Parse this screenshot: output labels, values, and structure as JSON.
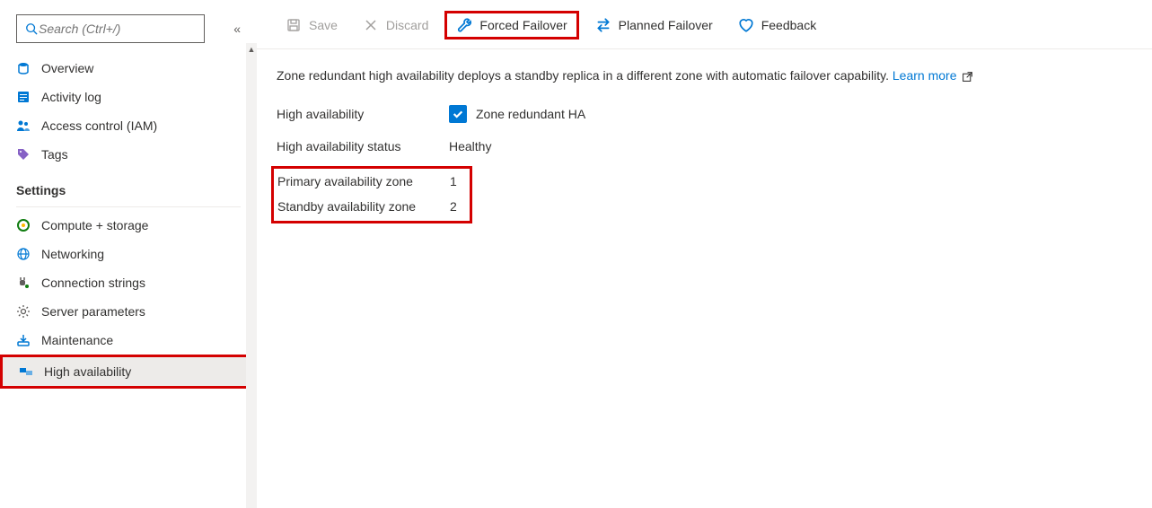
{
  "search": {
    "placeholder": "Search (Ctrl+/)"
  },
  "nav": {
    "overview": "Overview",
    "activity_log": "Activity log",
    "access_control": "Access control (IAM)",
    "tags": "Tags",
    "settings_header": "Settings",
    "compute_storage": "Compute + storage",
    "networking": "Networking",
    "connection_strings": "Connection strings",
    "server_parameters": "Server parameters",
    "maintenance": "Maintenance",
    "high_availability": "High availability"
  },
  "toolbar": {
    "save": "Save",
    "discard": "Discard",
    "forced_failover": "Forced Failover",
    "planned_failover": "Planned Failover",
    "feedback": "Feedback"
  },
  "description": {
    "text": "Zone redundant high availability deploys a standby replica in a different zone with automatic failover capability.",
    "learn_more": "Learn more"
  },
  "fields": {
    "ha_label": "High availability",
    "ha_checkbox_label": "Zone redundant HA",
    "ha_status_label": "High availability status",
    "ha_status_value": "Healthy",
    "primary_zone_label": "Primary availability zone",
    "primary_zone_value": "1",
    "standby_zone_label": "Standby availability zone",
    "standby_zone_value": "2"
  }
}
